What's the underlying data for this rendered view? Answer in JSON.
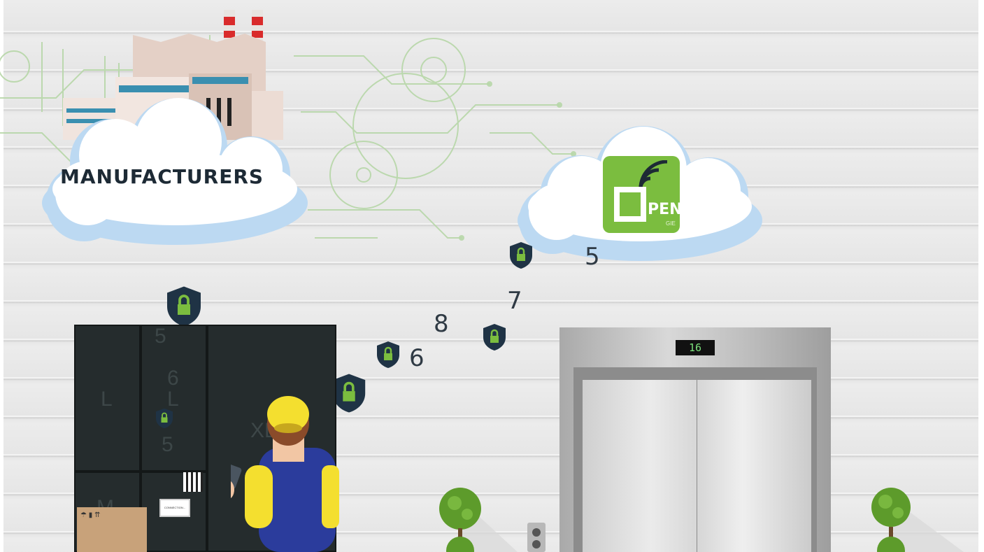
{
  "clouds": {
    "left_label": "MANUFACTURERS",
    "right_logo": {
      "main": "PEN",
      "sub": "GIE"
    }
  },
  "numbers": [
    "5",
    "7",
    "8",
    "6",
    "5",
    "6",
    "5"
  ],
  "locker": {
    "size_labels": [
      "L",
      "L",
      "XL",
      "M"
    ],
    "screen_text": "CONNECTION..."
  },
  "elevator": {
    "floor_display": "16"
  },
  "colors": {
    "accent_green": "#7bbd3f",
    "shield_navy": "#1f3345",
    "cloud_blue": "#bcd9f2",
    "locker": "#252c2d"
  },
  "icons": [
    "factory-icon",
    "shield-lock-icon",
    "wifi-signal-icon",
    "qr-code-icon",
    "fragile-box-icon",
    "tree-icon",
    "elevator-icon",
    "person-icon"
  ]
}
